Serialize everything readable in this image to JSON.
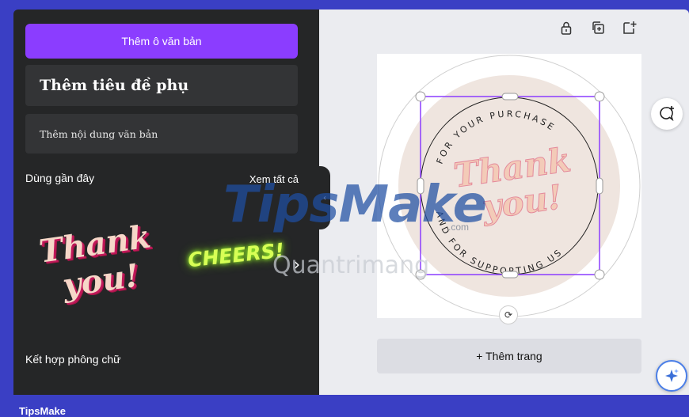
{
  "left_panel": {
    "add_text_button": "Thêm ô văn bản",
    "add_subtitle_button": "Thêm tiêu đề phụ",
    "add_body_button": "Thêm nội dung văn bản",
    "recent_title": "Dùng gần đây",
    "see_all": "Xem tất cả",
    "combo_title": "Kết hợp phông chữ",
    "recent_items": [
      {
        "line1": "Thank",
        "line2": "you!"
      },
      {
        "text": "CHEERS!"
      }
    ]
  },
  "design": {
    "circle_top_text": "FOR YOUR PURCHASE",
    "circle_bottom_text": "AND FOR SUPPORTING US",
    "center_line1": "Thank",
    "center_line2": "you!"
  },
  "canvas": {
    "add_page": "+ Thêm trang"
  },
  "watermark": {
    "main": "TipsMake",
    "com": ".com",
    "sub": "Quantrimang"
  },
  "footer": {
    "brand": "TipsMake"
  },
  "colors": {
    "frame": "#3a3fc4",
    "panel": "#252627",
    "accent": "#8b3dff",
    "selection": "#8b3dff"
  },
  "icons": {
    "lock": "lock-icon",
    "duplicate": "duplicate-icon",
    "add_page": "add-page-icon",
    "comment": "comment-add-icon",
    "magic": "sparkle-icon",
    "rotate": "rotate-icon"
  }
}
